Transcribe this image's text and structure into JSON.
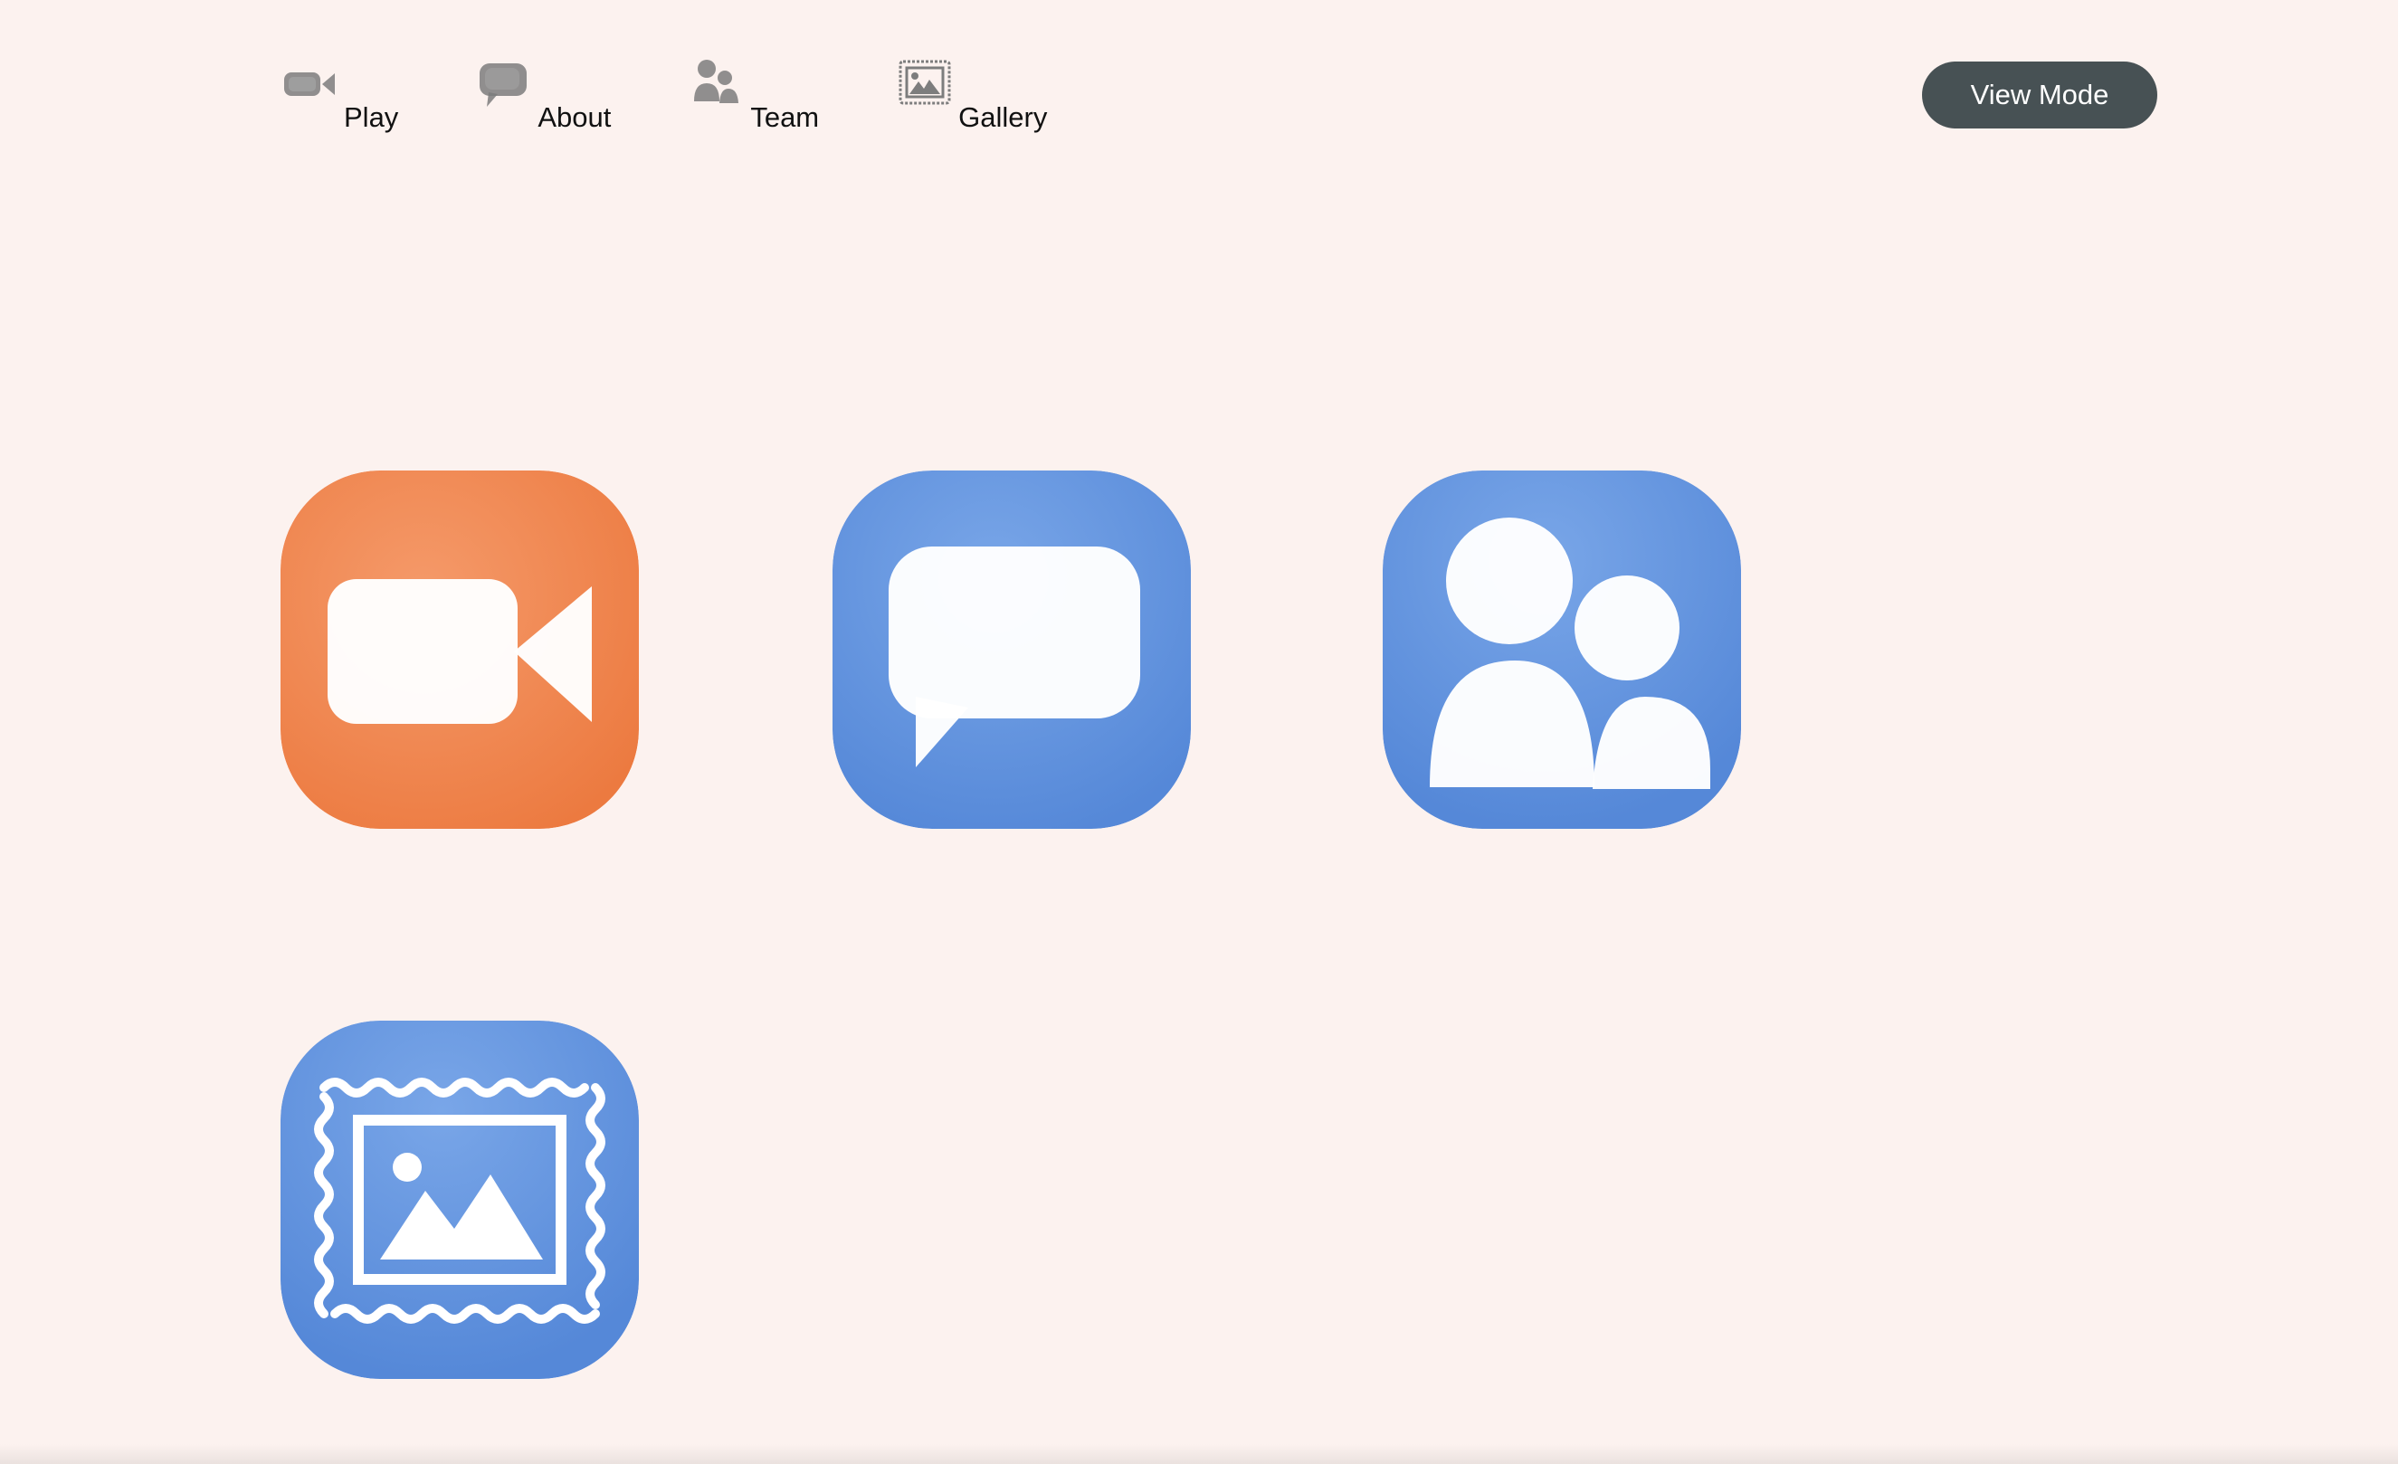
{
  "nav": {
    "items": [
      {
        "label": "Play",
        "icon": "video-camera-icon"
      },
      {
        "label": "About",
        "icon": "speech-bubble-icon"
      },
      {
        "label": "Team",
        "icon": "people-icon"
      },
      {
        "label": "Gallery",
        "icon": "framed-picture-icon"
      }
    ]
  },
  "header": {
    "view_mode_label": "View Mode"
  },
  "tiles": [
    {
      "icon": "video-camera-icon",
      "color": "#f0854f"
    },
    {
      "icon": "speech-bubble-icon",
      "color": "#5b8fdc"
    },
    {
      "icon": "people-icon",
      "color": "#5b8fdc"
    },
    {
      "icon": "framed-picture-icon",
      "color": "#5b8fdc"
    }
  ],
  "colors": {
    "background": "#fcf2ef",
    "button": "#475154",
    "orange": "#f0854f",
    "blue": "#5b8fdc"
  }
}
